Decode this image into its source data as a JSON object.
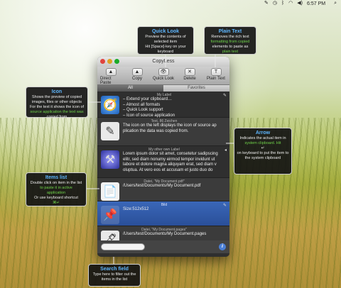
{
  "menubar": {
    "icons": [
      "script-icon",
      "clock-icon",
      "bluetooth-icon",
      "wifi-icon",
      "volume-icon"
    ],
    "time": "6:57 PM",
    "apple_glyph": "",
    "search_glyph": "⌕"
  },
  "window": {
    "title": "CopyLess",
    "toolbar": [
      {
        "label": "Direct Paste",
        "icon": "arrow-up-icon",
        "glyph": "▲"
      },
      {
        "label": "Copy",
        "icon": "arrow-up-icon",
        "glyph": "▲"
      },
      {
        "label": "Quick Look",
        "icon": "eye-icon",
        "glyph": "👁"
      },
      {
        "label": "Delete",
        "icon": "x-icon",
        "glyph": "✕"
      },
      {
        "label": "Plain Text",
        "icon": "text-icon",
        "glyph": "T"
      }
    ],
    "tabs": [
      "All",
      "Favorites"
    ],
    "items": [
      {
        "meta": "My Label",
        "text": "– Extend your clipboard…\n– Almost all formats\n– Quick Look support\n– Icon of source application",
        "icon": "safari-icon",
        "glyph": "🧭"
      },
      {
        "meta": "Text, 86 Zeichen",
        "text": "The icon on the left displays the icon of source ap plication the data was copied from.",
        "icon": "textedit-icon",
        "glyph": "✎"
      },
      {
        "meta": "My other own Label",
        "text": "Lorem ipsum dolor sit amet, consetetur sadipscing elitr, sed diam nonumy eirmod tempor invidunt ut labore et dolore magna aliquyam erat, sed diam v oluptua. At vero eos et accusam et justo duo do",
        "icon": "xcode-icon",
        "glyph": "⚒"
      },
      {
        "meta": "Datei, \"My Document.pdf\"",
        "text": "/Users/test/Documents/My Document.pdf",
        "icon": "pdf-file-icon",
        "glyph": "📄"
      },
      {
        "meta": "Bild",
        "text": "Size:512x512",
        "icon": "pushpin-icon",
        "glyph": "📌"
      },
      {
        "meta": "Datei, \"My Document.pages\"",
        "text": "/Users/test/Documents/My Document.pages",
        "icon": "pages-file-icon",
        "glyph": "🖋"
      }
    ],
    "search_placeholder": "",
    "info_glyph": "i"
  },
  "callouts": {
    "quick_look": {
      "title": "Quick Look",
      "l1": "Preview the contents of",
      "l2": "selected item",
      "l3": "Hit [Space]-key on your",
      "l4": "keyboard"
    },
    "plain_text": {
      "title": "Plain Text",
      "l1": "Removes the rich text",
      "l2": "formatting from copied",
      "l3": "elements to paste as",
      "l4": "plain text"
    },
    "icon": {
      "title": "Icon",
      "l1": "Shows the preview of copied",
      "l2": "images, files or other objects",
      "l3": "For the text it shows the icon of",
      "l4": "source application the text was",
      "l5": "copied from"
    },
    "arrow": {
      "title": "Arrow",
      "l1": "Indicates the actual item in",
      "l2": "system clipboard. Hit",
      "l3": "↵",
      "l4": "on keyboard to put the item to",
      "l5": "the system clipboard"
    },
    "items_list": {
      "title": "Items list",
      "l1": "Double click on item in the list",
      "l2": "to paste it in active",
      "l3": "application",
      "l4": "Or use keyboard shortcut",
      "l5": "⌘↵"
    },
    "search_field": {
      "title": "Search field",
      "l1": "Type here to filter out the",
      "l2": "items in the list"
    }
  }
}
